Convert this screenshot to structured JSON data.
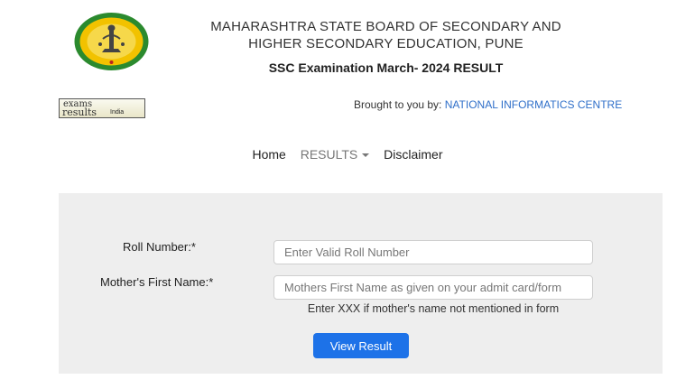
{
  "header": {
    "board_line_1": "MAHARASHTRA STATE BOARD OF SECONDARY AND",
    "board_line_2": "HIGHER SECONDARY EDUCATION, PUNE",
    "exam_title": "SSC Examination March- 2024 RESULT"
  },
  "exams_logo": {
    "line1": "exams",
    "line2": "results",
    "line3": "India"
  },
  "credit": {
    "prefix": "Brought to you by:",
    "org": "NATIONAL INFORMATICS CENTRE"
  },
  "nav": {
    "home": "Home",
    "results": "RESULTS",
    "disclaimer": "Disclaimer"
  },
  "form": {
    "roll_label": "Roll Number:*",
    "roll_placeholder": "Enter Valid Roll Number",
    "mother_label": "Mother's First Name:*",
    "mother_placeholder": "Mothers First Name as given on your admit card/form",
    "hint": "Enter XXX if mother's name not mentioned in form",
    "submit_label": "View Result"
  },
  "colors": {
    "link": "#2f6fc9",
    "button": "#1d72e8",
    "panel": "#eeeeee",
    "seal_ring": "#2b8a2e",
    "seal_fill": "#f2c200"
  }
}
